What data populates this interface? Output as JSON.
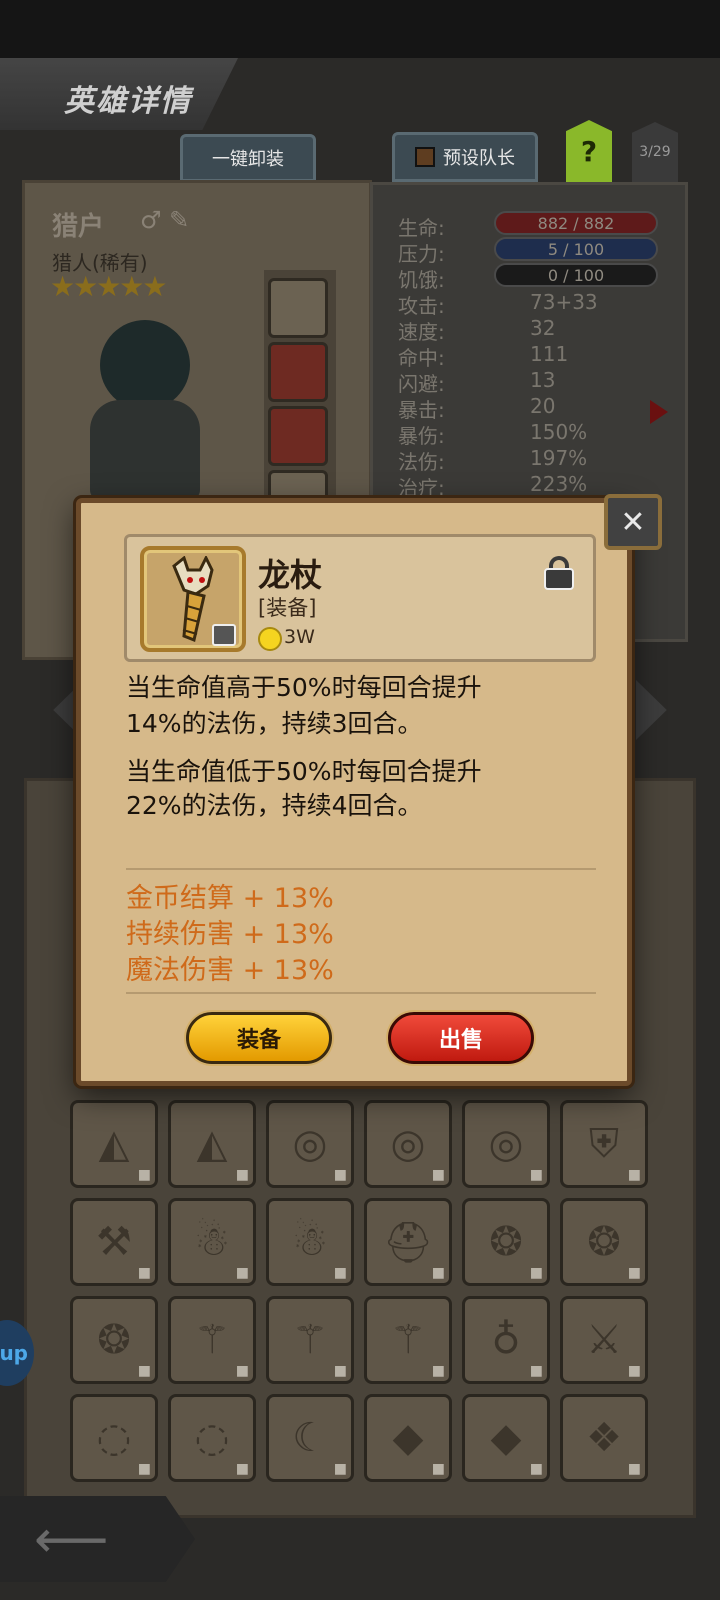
{
  "header": {
    "title": "英雄详情",
    "unequip_all": "一键卸装",
    "preset_leader": "预设队长",
    "help": "?",
    "page_indicator": "3/29"
  },
  "hero": {
    "name": "猎户",
    "class": "猎人(稀有)",
    "stars": "★★★★★",
    "star_count": 5
  },
  "stats": {
    "hp_label": "生命:",
    "hp_value": "882 / 882",
    "stress_label": "压力:",
    "stress_value": "5 / 100",
    "hunger_label": "饥饿:",
    "hunger_value": "0 / 100",
    "attack_label": "攻击:",
    "attack_value": "73+33",
    "speed_label": "速度:",
    "speed_value": "32",
    "accuracy_label": "命中:",
    "accuracy_value": "111",
    "dodge_label": "闪避:",
    "dodge_value": "13",
    "crit_label": "暴击:",
    "crit_value": "20",
    "crit_dmg_label": "暴伤:",
    "crit_dmg_value": "150%",
    "magic_dmg_label": "法伤:",
    "magic_dmg_value": "197%",
    "heal_label": "治疗:",
    "heal_value": "223%"
  },
  "item": {
    "name": "龙杖",
    "type": "[装备]",
    "price": "3W",
    "desc_line1": "当生命值高于50%时每回合提升",
    "desc_line2": "14%的法伤，持续3回合。",
    "desc_line3": "当生命值低于50%时每回合提升",
    "desc_line4": "22%的法伤，持续4回合。",
    "bonus1": "金币结算 + 13%",
    "bonus2": "持续伤害 + 13%",
    "bonus3": "魔法伤害 + 13%",
    "equip_label": "装备",
    "sell_label": "出售"
  },
  "inventory": [
    {
      "icon": "◭"
    },
    {
      "icon": "◭"
    },
    {
      "icon": "◎"
    },
    {
      "icon": "◎"
    },
    {
      "icon": "◎"
    },
    {
      "icon": "⛨"
    },
    {
      "icon": "⚒"
    },
    {
      "icon": "☃"
    },
    {
      "icon": "☃"
    },
    {
      "icon": "⛑"
    },
    {
      "icon": "❂"
    },
    {
      "icon": "❂"
    },
    {
      "icon": "❂"
    },
    {
      "icon": "⚚"
    },
    {
      "icon": "⚚"
    },
    {
      "icon": "⚚"
    },
    {
      "icon": "♁"
    },
    {
      "icon": "⚔"
    },
    {
      "icon": "◌"
    },
    {
      "icon": "◌"
    },
    {
      "icon": "☾"
    },
    {
      "icon": "◆"
    },
    {
      "icon": "◆"
    },
    {
      "icon": "❖"
    }
  ],
  "side_tab_label": "up",
  "colors": {
    "modal_bg": "#d6b98a",
    "bonus_orange": "#cf6a1a",
    "equip_yellow": "#ffd23a",
    "sell_red": "#e0281c"
  }
}
